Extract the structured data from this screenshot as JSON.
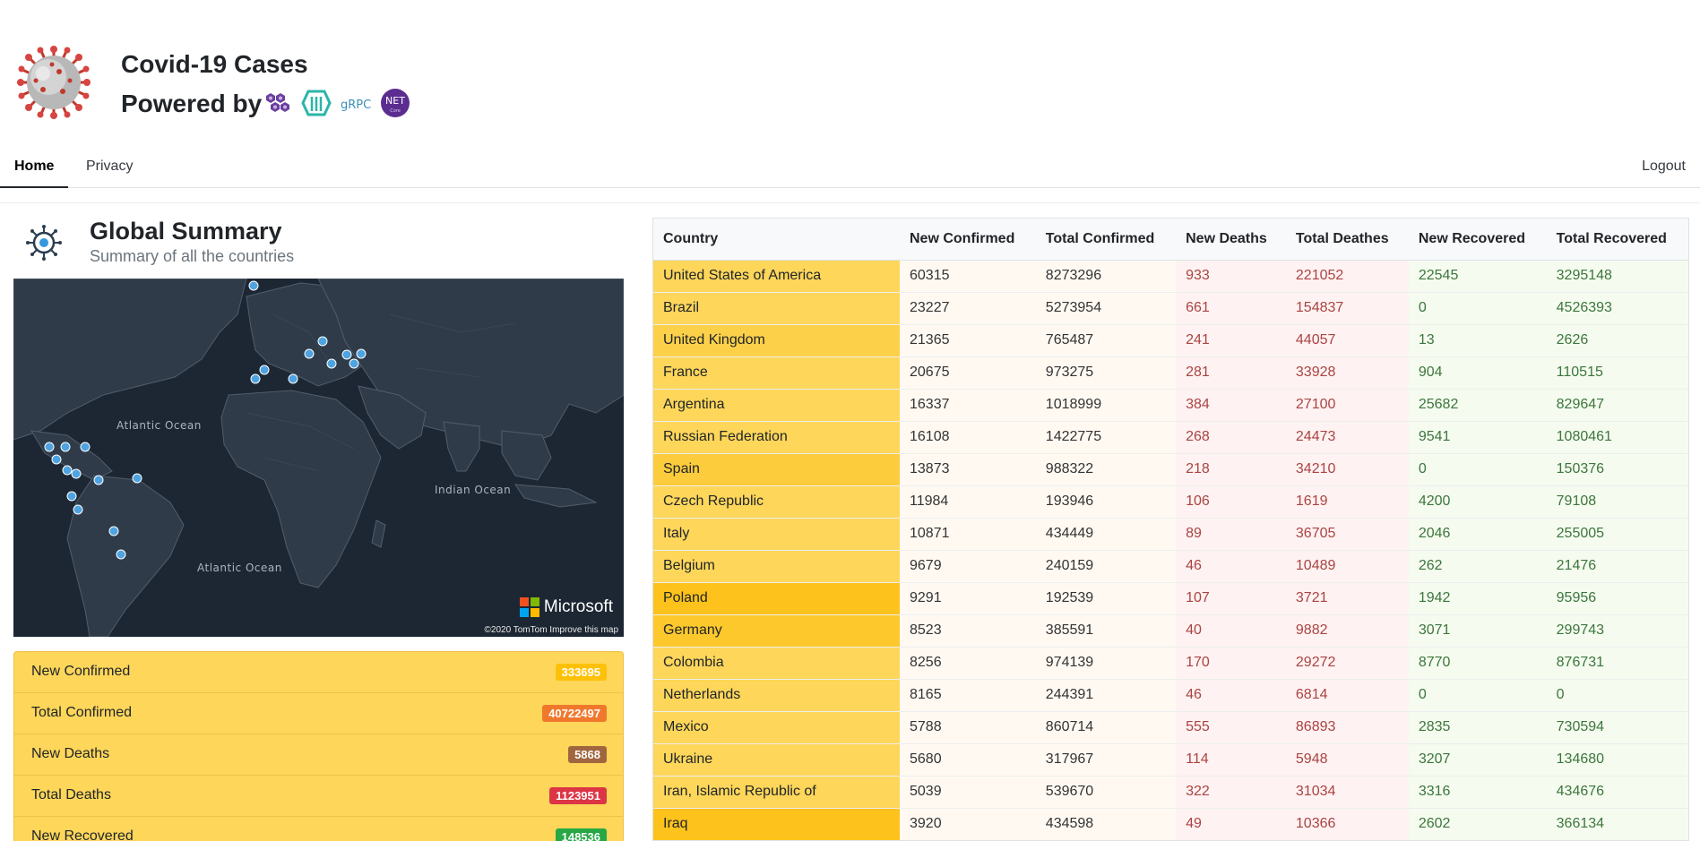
{
  "header": {
    "title": "Covid-19 Cases",
    "powered_by": "Powered by",
    "tech_logos": [
      "dapr-icon",
      "kubernetes-icon",
      "grpc",
      "dotnet-core-icon"
    ],
    "grpc_label": "gRPC",
    "net_label": "NET"
  },
  "nav": {
    "home": "Home",
    "privacy": "Privacy",
    "logout": "Logout"
  },
  "global_summary": {
    "title": "Global Summary",
    "subtitle": "Summary of all the countries"
  },
  "map": {
    "labels": [
      "Atlantic Ocean",
      "Indian Ocean",
      "Atlantic Ocean"
    ],
    "brand": "Microsoft",
    "attribution": "©2020 TomTom  Improve this map"
  },
  "summary": [
    {
      "label": "New Confirmed",
      "value": "333695",
      "color": "#ffc107"
    },
    {
      "label": "Total Confirmed",
      "value": "40722497",
      "color": "#f0782d"
    },
    {
      "label": "New Deaths",
      "value": "5868",
      "color": "#a0663f"
    },
    {
      "label": "Total Deaths",
      "value": "1123951",
      "color": "#dc3545"
    },
    {
      "label": "New Recovered",
      "value": "148536",
      "color": "#28a745"
    }
  ],
  "table": {
    "headers": [
      "Country",
      "New Confirmed",
      "Total Confirmed",
      "New Deaths",
      "Total Deathes",
      "New Recovered",
      "Total Recovered"
    ],
    "rows": [
      {
        "country": "United States of America",
        "nc": "60315",
        "tc": "8273296",
        "nd": "933",
        "td": "221052",
        "nr": "22545",
        "tr": "3295148",
        "shade": "#fdd65a"
      },
      {
        "country": "Brazil",
        "nc": "23227",
        "tc": "5273954",
        "nd": "661",
        "td": "154837",
        "nr": "0",
        "tr": "4526393",
        "shade": "#fdd65a"
      },
      {
        "country": "United Kingdom",
        "nc": "21365",
        "tc": "765487",
        "nd": "241",
        "td": "44057",
        "nr": "13",
        "tr": "2626",
        "shade": "#fdd04a"
      },
      {
        "country": "France",
        "nc": "20675",
        "tc": "973275",
        "nd": "281",
        "td": "33928",
        "nr": "904",
        "tr": "110515",
        "shade": "#fdd65a"
      },
      {
        "country": "Argentina",
        "nc": "16337",
        "tc": "1018999",
        "nd": "384",
        "td": "27100",
        "nr": "25682",
        "tr": "829647",
        "shade": "#fdd65a"
      },
      {
        "country": "Russian Federation",
        "nc": "16108",
        "tc": "1422775",
        "nd": "268",
        "td": "24473",
        "nr": "9541",
        "tr": "1080461",
        "shade": "#fdd65a"
      },
      {
        "country": "Spain",
        "nc": "13873",
        "tc": "988322",
        "nd": "218",
        "td": "34210",
        "nr": "0",
        "tr": "150376",
        "shade": "#fdcc3c"
      },
      {
        "country": "Czech Republic",
        "nc": "11984",
        "tc": "193946",
        "nd": "106",
        "td": "1619",
        "nr": "4200",
        "tr": "79108",
        "shade": "#fdd65a"
      },
      {
        "country": "Italy",
        "nc": "10871",
        "tc": "434449",
        "nd": "89",
        "td": "36705",
        "nr": "2046",
        "tr": "255005",
        "shade": "#fdd65a"
      },
      {
        "country": "Belgium",
        "nc": "9679",
        "tc": "240159",
        "nd": "46",
        "td": "10489",
        "nr": "262",
        "tr": "21476",
        "shade": "#fdd65a"
      },
      {
        "country": "Poland",
        "nc": "9291",
        "tc": "192539",
        "nd": "107",
        "td": "3721",
        "nr": "1942",
        "tr": "95956",
        "shade": "#fdc21c"
      },
      {
        "country": "Germany",
        "nc": "8523",
        "tc": "385591",
        "nd": "40",
        "td": "9882",
        "nr": "3071",
        "tr": "299743",
        "shade": "#fdc82c"
      },
      {
        "country": "Colombia",
        "nc": "8256",
        "tc": "974139",
        "nd": "170",
        "td": "29272",
        "nr": "8770",
        "tr": "876731",
        "shade": "#fdd65a"
      },
      {
        "country": "Netherlands",
        "nc": "8165",
        "tc": "244391",
        "nd": "46",
        "td": "6814",
        "nr": "0",
        "tr": "0",
        "shade": "#fdd65a"
      },
      {
        "country": "Mexico",
        "nc": "5788",
        "tc": "860714",
        "nd": "555",
        "td": "86893",
        "nr": "2835",
        "tr": "730594",
        "shade": "#fdd65a"
      },
      {
        "country": "Ukraine",
        "nc": "5680",
        "tc": "317967",
        "nd": "114",
        "td": "5948",
        "nr": "3207",
        "tr": "134680",
        "shade": "#fdd65a"
      },
      {
        "country": "Iran, Islamic Republic of",
        "nc": "5039",
        "tc": "539670",
        "nd": "322",
        "td": "31034",
        "nr": "3316",
        "tr": "434676",
        "shade": "#fdd65a"
      },
      {
        "country": "Iraq",
        "nc": "3920",
        "tc": "434598",
        "nd": "49",
        "td": "10366",
        "nr": "2602",
        "tr": "366134",
        "shade": "#fdc21c"
      }
    ]
  }
}
